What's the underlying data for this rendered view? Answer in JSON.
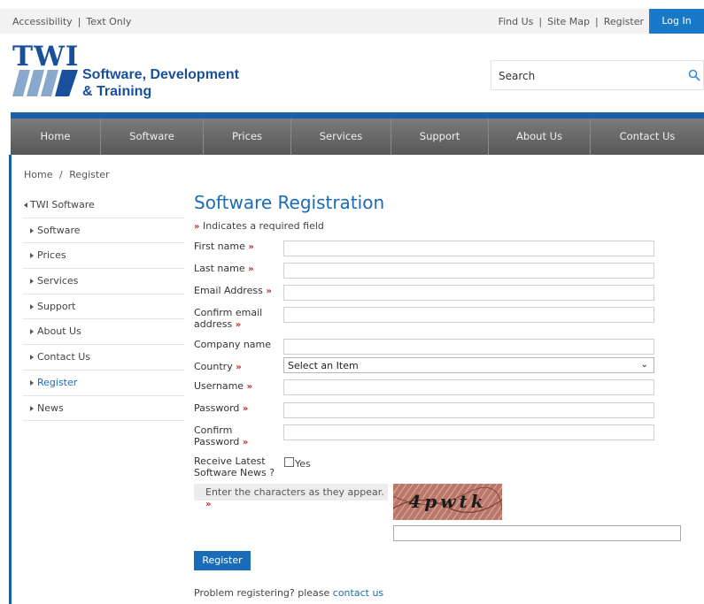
{
  "topbar": {
    "accessibility": "Accessibility",
    "text_only": "Text Only",
    "find_us": "Find Us",
    "site_map": "Site Map",
    "register": "Register",
    "log_in": "Log In"
  },
  "logo": {
    "twi": "TWI",
    "line1": "Software, Development",
    "line2": "& Training"
  },
  "search": {
    "placeholder": "Search",
    "icon": "search-icon"
  },
  "nav": [
    {
      "label": "Home"
    },
    {
      "label": "Software"
    },
    {
      "label": "Prices"
    },
    {
      "label": "Services"
    },
    {
      "label": "Support"
    },
    {
      "label": "About Us"
    },
    {
      "label": "Contact Us"
    }
  ],
  "breadcrumb": {
    "home": "Home",
    "separator": "/",
    "current": "Register"
  },
  "sidebar": {
    "parent": "TWI Software",
    "items": [
      {
        "label": "Software"
      },
      {
        "label": "Prices"
      },
      {
        "label": "Services"
      },
      {
        "label": "Support"
      },
      {
        "label": "About Us"
      },
      {
        "label": "Contact Us"
      },
      {
        "label": "Register"
      },
      {
        "label": "News"
      }
    ]
  },
  "form": {
    "title": "Software Registration",
    "required_marker": "»",
    "required_note": "Indicates a required field",
    "first_name": "First name",
    "last_name": "Last name",
    "email": "Email Address",
    "confirm_email_1": "Confirm email",
    "confirm_email_2": "address",
    "company": "Company name",
    "country": "Country",
    "country_selected": "Select an Item",
    "username": "Username",
    "password": "Password",
    "confirm_password_1": "Confirm",
    "confirm_password_2": "Password",
    "news_1": "Receive Latest",
    "news_2": "Software News ?",
    "news_yes": "Yes",
    "captcha_prompt": "Enter the characters as they appear.",
    "captcha_text": "4pwtk",
    "register_button": "Register",
    "problem_text": "Problem registering? please",
    "contact_link": "contact us"
  },
  "colors": {
    "brand_blue": "#1a6cb8",
    "logo_blue": "#1a4f9c",
    "required_red": "#c0282d",
    "nav_gray": "#666666",
    "login_blue": "#1779c8"
  }
}
